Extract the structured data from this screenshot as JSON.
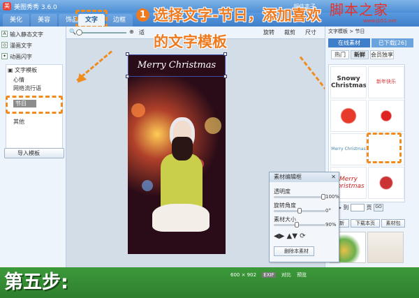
{
  "app": {
    "title": "美图秀秀 3.6.0",
    "user": "胡佳丰子"
  },
  "logo": {
    "text": "脚本之家",
    "sub": "www.jb51.net"
  },
  "tabs": [
    "美化",
    "美容",
    "饰品",
    "文字",
    "边框"
  ],
  "active_tab": "文字",
  "toolbar": {
    "zoom_label": "Q",
    "rotate": "旋转",
    "crop": "裁剪",
    "size": "尺寸",
    "fit": "适"
  },
  "left_panel": {
    "items": [
      "输入静态文字",
      "漫画文字",
      "动画闪字"
    ],
    "tree_title": "文字模板",
    "tree_items": [
      "心情",
      "网络流行语",
      "节日",
      "其他"
    ],
    "selected": "节日",
    "import_button": "导入模板"
  },
  "canvas_text": {
    "merry": "Merry Christmas"
  },
  "instructions": {
    "badge": "1",
    "line1": "选择文字-节日，添加喜欢",
    "line2": "的文字模板"
  },
  "right_panel": {
    "top_label": "文字模板 > 节日",
    "tabs": [
      "在线素材",
      "已下载[26]"
    ],
    "subtabs": [
      "热门",
      "新鲜",
      "会员独享"
    ],
    "cells": [
      "Snowy Christmas!",
      "新年快乐",
      "",
      "",
      "Merry Christmas",
      "",
      "Merry Christmas",
      ""
    ],
    "pager": {
      "to": "到",
      "page": "页",
      "go": "GO"
    },
    "buttons": [
      "刷新",
      "下载本页",
      "素材包"
    ]
  },
  "editor": {
    "title": "素材编辑框",
    "opacity_label": "透明度",
    "opacity_value": "100%",
    "rotate_label": "旋转角度",
    "rotate_value": "0°",
    "size_label": "素材大小",
    "size_value": "90%",
    "delete": "删除本素材"
  },
  "statusbar": {
    "step": "第五步:",
    "dims": "600 × 902",
    "exif": "EXIF",
    "compare": "对比",
    "preview": "预览"
  },
  "colors": {
    "accent": "#f08c1e",
    "blue": "#3f7fc9",
    "green": "#3c9a3a"
  }
}
